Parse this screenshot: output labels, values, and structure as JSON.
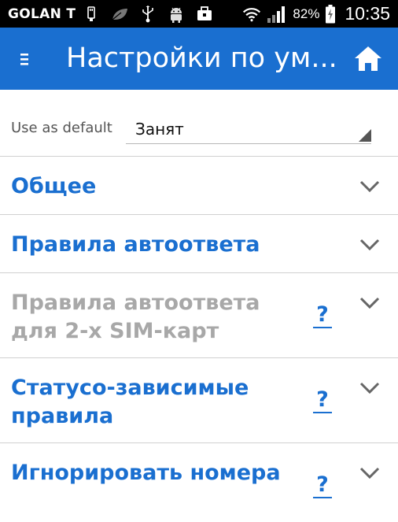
{
  "status_bar": {
    "carrier": "GOLAN T",
    "battery_percent": "82%",
    "time": "10:35",
    "icons": [
      "usb-icon",
      "leaf-icon",
      "usb-debug-icon",
      "android-icon",
      "briefcase-icon",
      "wifi-icon",
      "signal-icon",
      "battery-charging-icon"
    ]
  },
  "app_bar": {
    "title": "Настройки по ум...",
    "menu_icon": "menu-icon",
    "home_icon": "home-icon",
    "color": "#1a6fd0"
  },
  "default_setting": {
    "label": "Use as default",
    "value": "Занят"
  },
  "sections": [
    {
      "label": "Общее",
      "enabled": true,
      "help": false
    },
    {
      "label": "Правила автоответа",
      "enabled": true,
      "help": false
    },
    {
      "label": "Правила автоответа для 2-х SIM-карт",
      "enabled": false,
      "help": true
    },
    {
      "label": "Статусо-зависимые правила",
      "enabled": true,
      "help": true
    },
    {
      "label": "Игнорировать  номера",
      "enabled": true,
      "help": true
    }
  ],
  "help_label": "?"
}
